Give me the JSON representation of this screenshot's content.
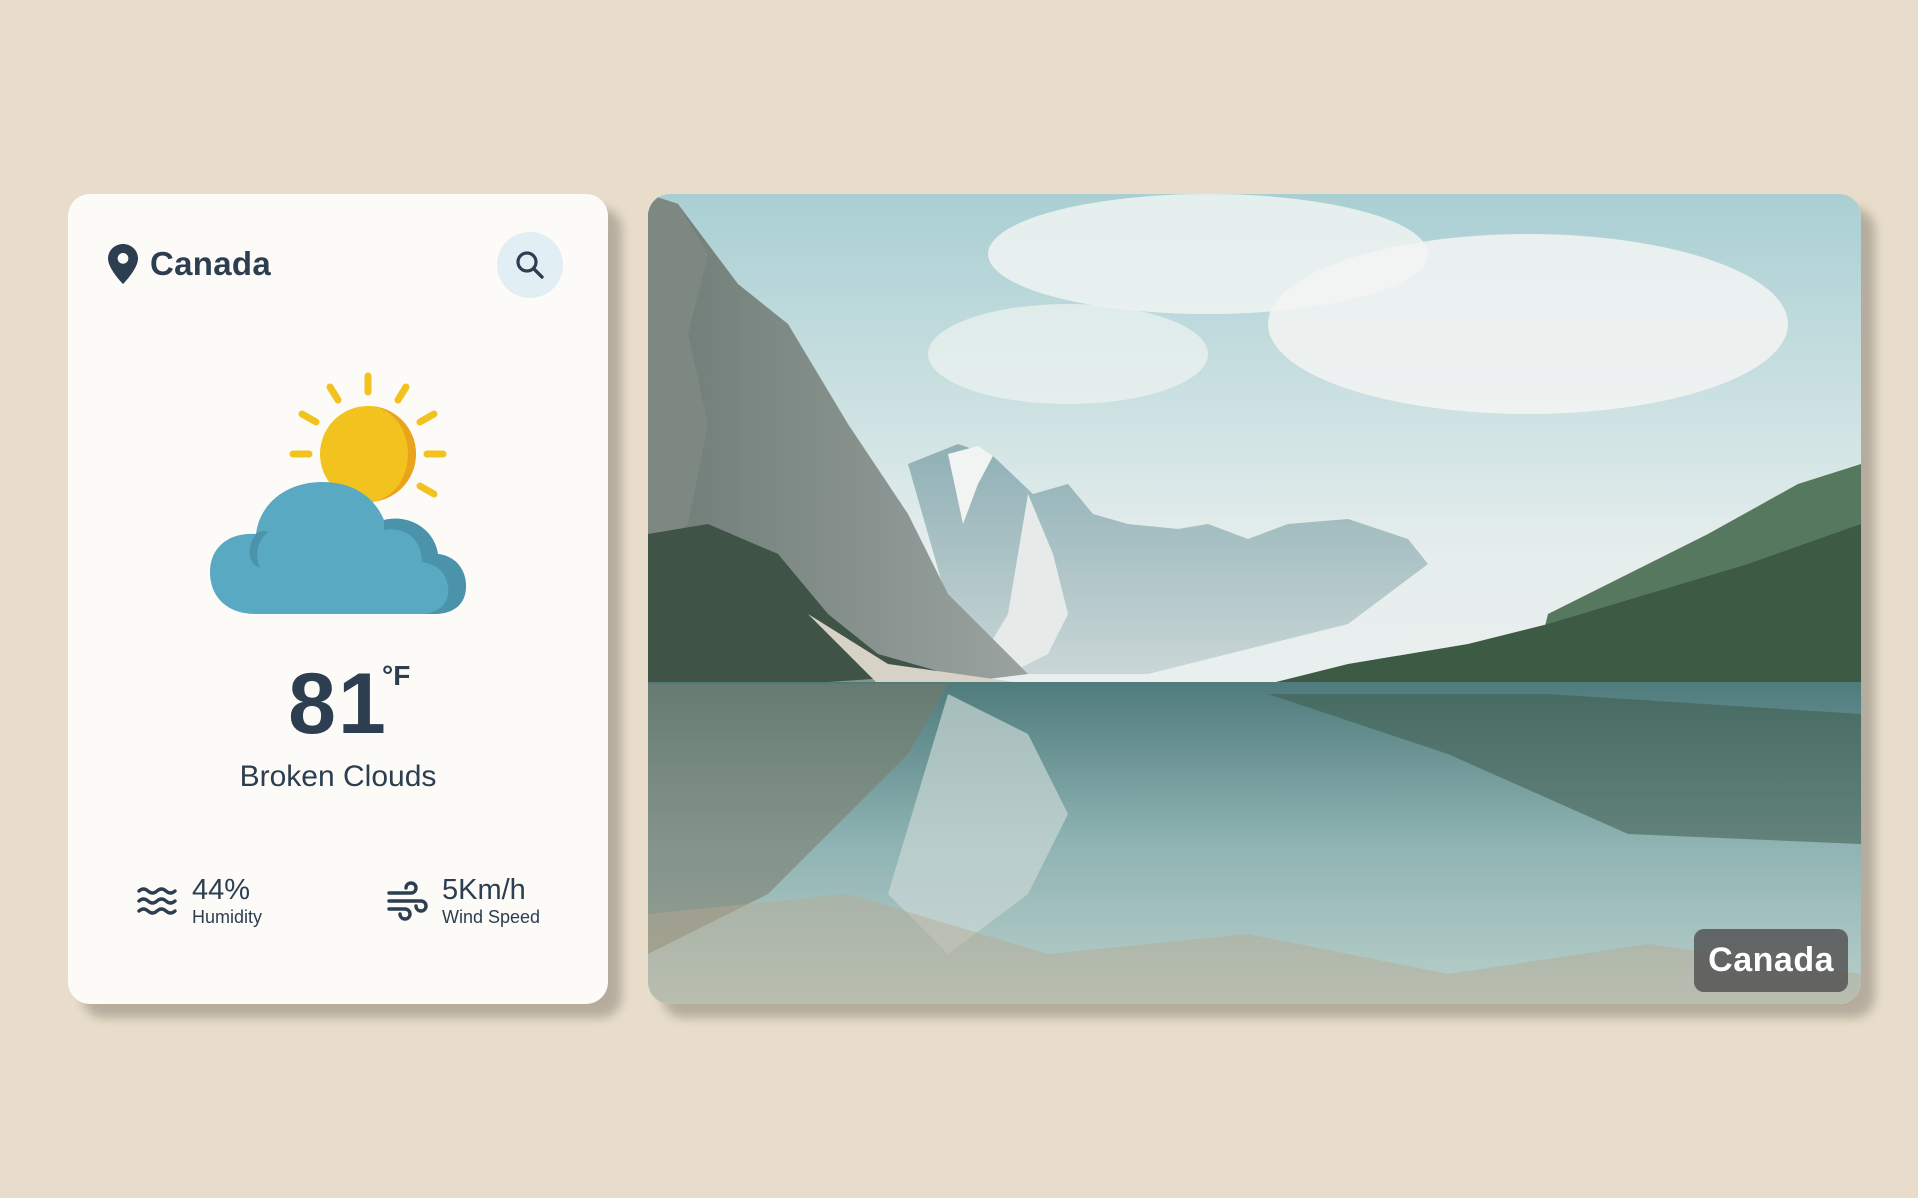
{
  "location": {
    "name": "Canada",
    "icon": "map-pin-icon"
  },
  "search": {
    "icon": "search-icon"
  },
  "weather": {
    "icon": "sun-behind-cloud-icon",
    "temperature": "81",
    "unit": "°F",
    "condition": "Broken Clouds"
  },
  "stats": {
    "humidity": {
      "value": "44%",
      "label": "Humidity",
      "icon": "water-waves-icon"
    },
    "wind": {
      "value": "5Km/h",
      "label": "Wind Speed",
      "icon": "wind-icon"
    }
  },
  "photo": {
    "badge": "Canada"
  },
  "colors": {
    "background": "#e8ddca",
    "card": "#fcfbf8",
    "text": "#2c3e50",
    "search_bg": "#e1eef4",
    "sun": "#f2c21f",
    "cloud": "#5aa9c2"
  }
}
